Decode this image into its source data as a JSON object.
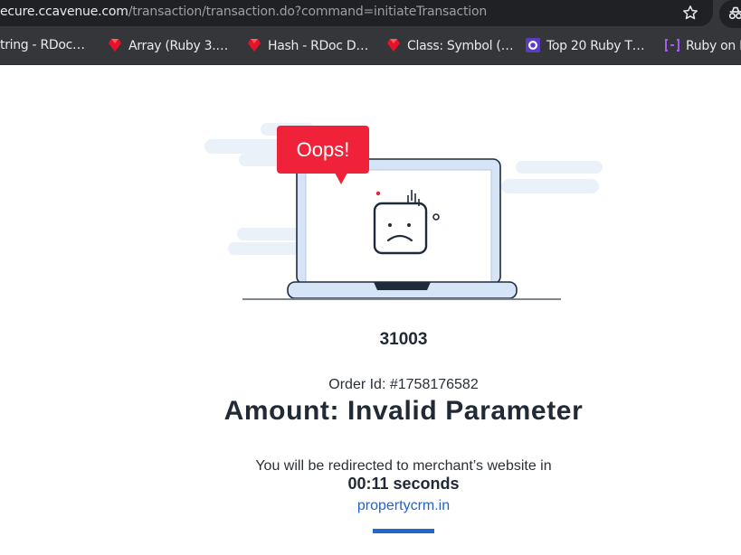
{
  "browser": {
    "url_prefix": "ecure.ccavenue.com",
    "url_path": "/transaction/transaction.do?command=initiateTransaction",
    "bookmarks": [
      {
        "label": "tring - RDoc…",
        "favicon": "none"
      },
      {
        "label": "Array (Ruby 3.…",
        "favicon": "ruby-icon"
      },
      {
        "label": "Hash - RDoc D…",
        "favicon": "ruby-icon"
      },
      {
        "label": "Class: Symbol (…",
        "favicon": "ruby-icon"
      },
      {
        "label": "Top 20 Ruby T…",
        "favicon": "purple-a-icon"
      },
      {
        "label": "Ruby on R",
        "favicon": "bracket-icon"
      }
    ]
  },
  "page": {
    "illustration_badge": "Oops!",
    "error_code": "31003",
    "order_id": "Order Id: #1758176582",
    "amount_message": "Amount: Invalid Parameter",
    "redirect_message": "You will be redirected to merchant’s website in",
    "timer_value": "00:11",
    "timer_unit": "seconds",
    "merchant_link": "propertycrm.in",
    "redirect_progress": 1.0
  },
  "colors": {
    "badge_red": "#f0223a",
    "link_blue": "#2563c9",
    "progress_blue": "#1f69c8",
    "heading_dark": "#222a36"
  }
}
